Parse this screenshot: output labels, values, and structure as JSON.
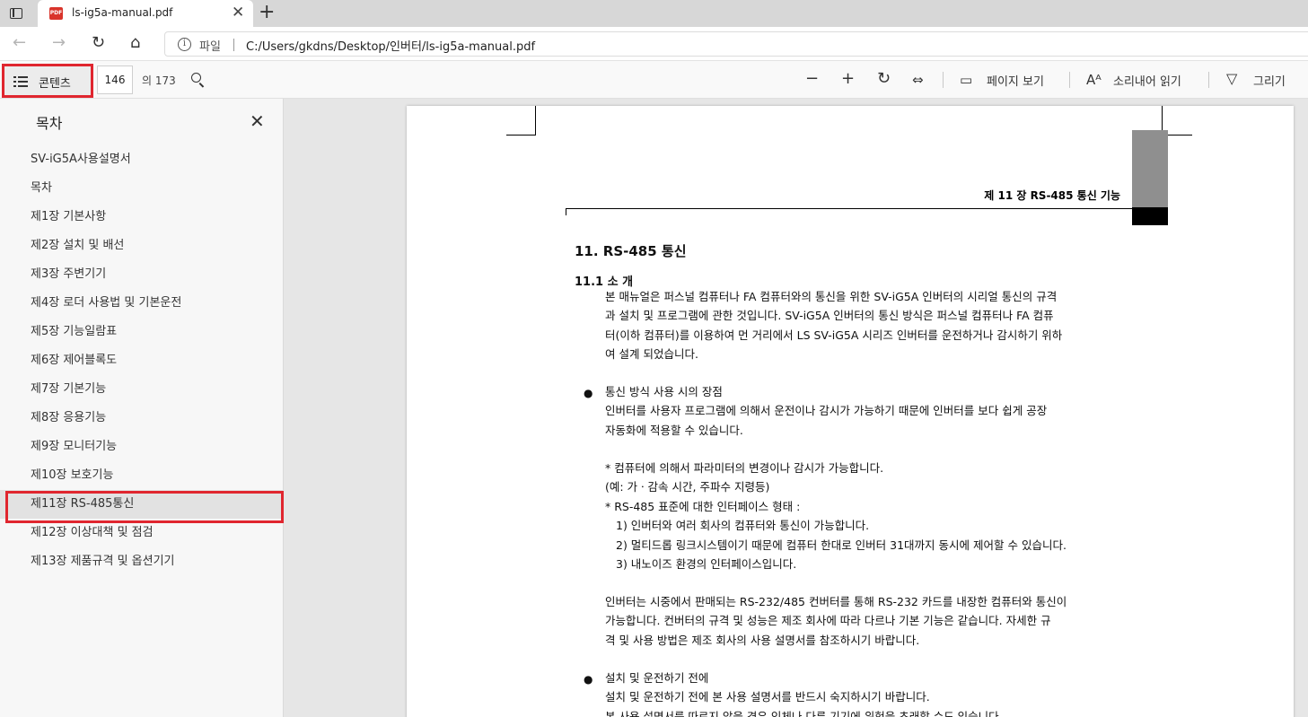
{
  "browser": {
    "tab_title": "ls-ig5a-manual.pdf",
    "pdf_badge": "PDF",
    "close_glyph": "✕",
    "new_tab_glyph": "+",
    "address": {
      "file_label": "파일",
      "url": "C:/Users/gkdns/Desktop/인버터/ls-ig5a-manual.pdf"
    }
  },
  "pdf_toolbar": {
    "contents_label": "콘텐츠",
    "page_number": "146",
    "page_total": "의 173",
    "page_view_label": "페이지 보기",
    "read_aloud_label": "소리내어 읽기",
    "draw_label": "그리기"
  },
  "sidebar": {
    "title": "목차",
    "items": [
      "SV-iG5A사용설명서",
      "목차",
      "제1장 기본사항",
      "제2장 설치 및 배선",
      "제3장 주변기기",
      "제4장 로더 사용법 및 기본운전",
      "제5장 기능일람표",
      "제6장 제어블록도",
      "제7장 기본기능",
      "제8장 응용기능",
      "제9장 모니터기능",
      "제10장 보호기능",
      "제11장 RS-485통신",
      "제12장 이상대책 및 점검",
      "제13장 제품규격 및 옵션기기"
    ],
    "active_index": 12
  },
  "document": {
    "running_head": "제 11 장 RS-485 통신 기능",
    "heading": "11. RS-485 통신",
    "subheading": "11.1  소 개",
    "intro_lines": [
      "본 매뉴얼은 퍼스널 컴퓨터나 FA 컴퓨터와의 통신을 위한 SV-iG5A 인버터의 시리얼 통신의 규격",
      "과 설치 및 프로그램에 관한 것입니다. SV-iG5A 인버터의 통신 방식은 퍼스널 컴퓨터나 FA 컴퓨",
      "터(이하 컴퓨터)를 이용하여 먼 거리에서 LS SV-iG5A 시리즈 인버터를 운전하거나 감시하기 위하",
      "여 설계 되었습니다."
    ],
    "bullet1_title": "통신 방식 사용 시의 장점",
    "bullet1_lines": [
      "인버터를 사용자 프로그램에 의해서 운전이나 감시가 가능하기 때문에 인버터를 보다 쉽게 공장",
      "자동화에 적용할 수 있습니다."
    ],
    "feature_lines": [
      "* 컴퓨터에 의해서 파라미터의 변경이나 감시가 가능합니다.",
      "(예: 가ㆍ감속 시간, 주파수 지령등)",
      "* RS-485 표준에 대한 인터페이스 형태 :",
      "  1) 인버터와 여러 회사의 컴퓨터와 통신이 가능합니다.",
      "  2) 멀티드롭 링크시스템이기 때문에 컴퓨터 한대로 인버터 31대까지 동시에 제어할 수 있습니다.",
      "  3) 내노이즈 환경의 인터페이스입니다."
    ],
    "converter_lines": [
      "인버터는 시중에서 판매되는 RS-232/485 컨버터를 통해 RS-232 카드를 내장한 컴퓨터와 통신이",
      "가능합니다. 컨버터의 규격 및 성능은 제조 회사에 따라 다르나 기본 기능은 같습니다. 자세한 규",
      "격 및 사용 방법은 제조 회사의 사용 설명서를 참조하시기 바랍니다."
    ],
    "bullet2_title": "설치 및 운전하기 전에",
    "bullet2_lines": [
      "설치 및 운전하기 전에 본 사용 설명서를 반드시 숙지하시기 바랍니다.",
      "본 사용 설명서를 따르지 않을 경우 인체나 다른 기기에 위험을 초래할 수도 있습니다."
    ],
    "bullet_glyph": "●"
  }
}
